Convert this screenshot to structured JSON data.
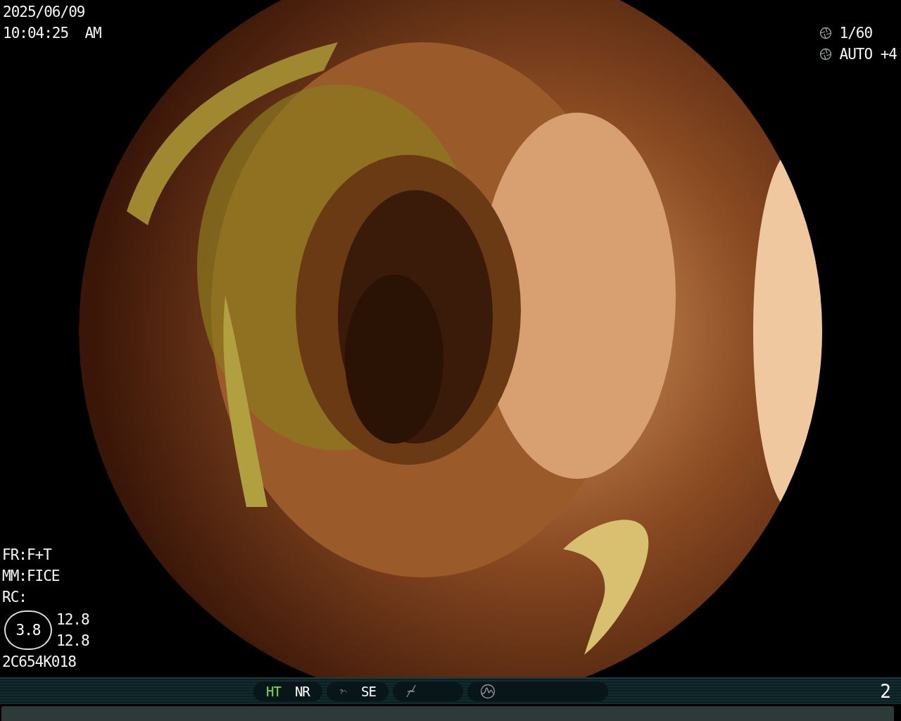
{
  "timestamp": {
    "date": "2025/06/09",
    "time": "10:04:25",
    "meridiem": "AM"
  },
  "camera": {
    "shutter": "1/60",
    "iris": "AUTO +4"
  },
  "settings": [
    "FR:F+T",
    "MM:FICE",
    "RC:"
  ],
  "zoom": {
    "value": "3.8",
    "readings": [
      "12.8",
      "12.8"
    ]
  },
  "scope_id": "2C654K018",
  "status_bar": {
    "groups": [
      {
        "items": [
          {
            "kind": "label",
            "text": "HT",
            "on": true
          },
          {
            "kind": "label",
            "text": "NR",
            "on": false
          }
        ]
      },
      {
        "items": [
          {
            "kind": "curve-icon"
          },
          {
            "kind": "label",
            "text": "SE",
            "on": false
          }
        ]
      },
      {
        "items": [
          {
            "kind": "function-icon"
          }
        ]
      },
      {
        "items": [
          {
            "kind": "peak-icon"
          }
        ]
      }
    ],
    "page": "2"
  }
}
